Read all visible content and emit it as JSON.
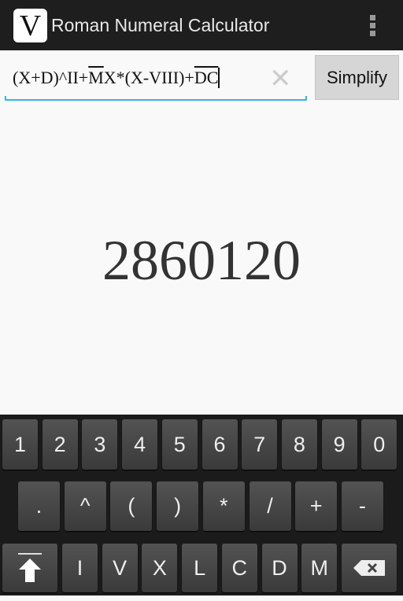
{
  "app": {
    "title": "Roman Numeral Calculator",
    "logo": "V",
    "menu_icon": "overflow-menu-icon"
  },
  "input": {
    "segments": [
      {
        "text": "(X+D)^II+",
        "overline": false
      },
      {
        "text": "M",
        "overline": true
      },
      {
        "text": "X*(X-VIII)+",
        "overline": false
      },
      {
        "text": "DC",
        "overline": true
      }
    ],
    "clear_icon": "✕"
  },
  "simplify_label": "Simplify",
  "result": "2860120",
  "keyboard": {
    "row1": [
      "1",
      "2",
      "3",
      "4",
      "5",
      "6",
      "7",
      "8",
      "9",
      "0"
    ],
    "row2": [
      ".",
      "^",
      "(",
      ")",
      "*",
      "/",
      "+",
      "-"
    ],
    "row3": [
      "I",
      "V",
      "X",
      "L",
      "C",
      "D",
      "M"
    ],
    "accent": "#33b5e5"
  }
}
